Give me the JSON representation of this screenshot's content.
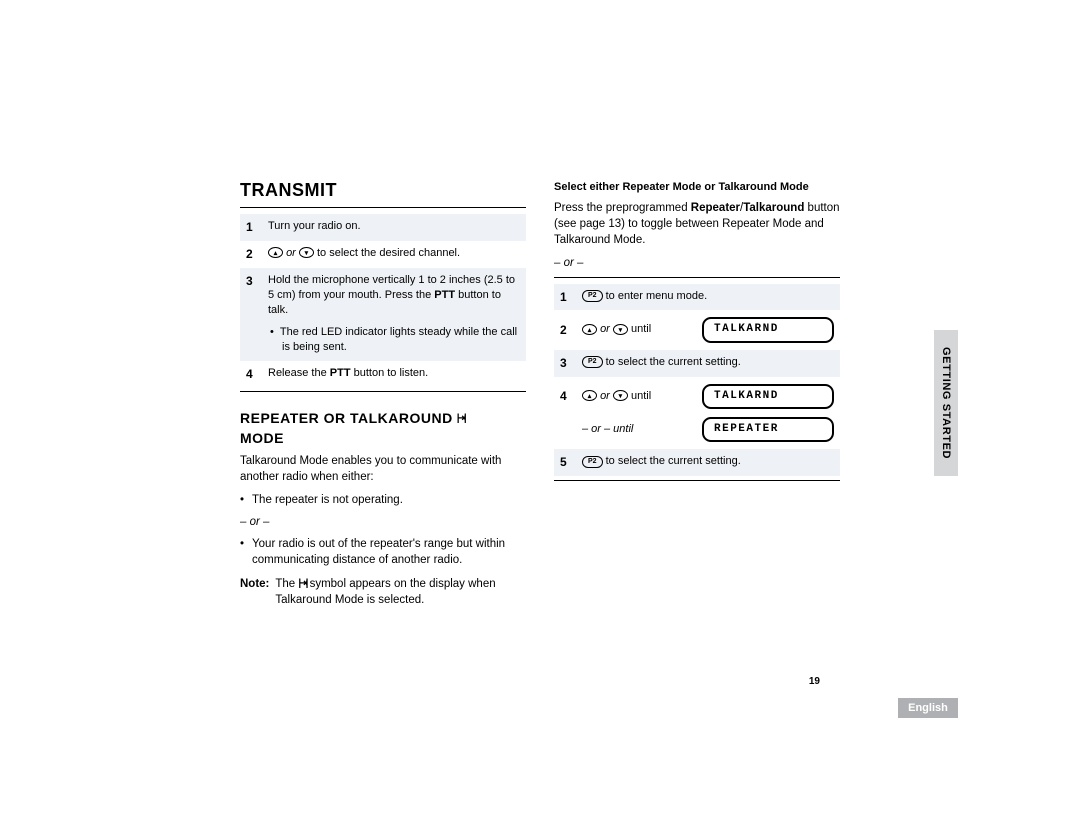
{
  "left": {
    "h1": "TRANSMIT",
    "steps": [
      {
        "n": "1",
        "text": "Turn your radio on."
      },
      {
        "n": "2",
        "pre": "",
        "mid": " or ",
        "post": " to select the desired channel."
      },
      {
        "n": "3",
        "text": "Hold the microphone vertically 1 to 2 inches (2.5 to 5 cm) from your mouth. Press the ",
        "bold": "PTT",
        "after": " button to talk.",
        "nested": "The red LED indicator lights steady while the call is being sent."
      },
      {
        "n": "4",
        "text": "Release the ",
        "bold": "PTT",
        "after": " button to listen."
      }
    ],
    "h2a": "REPEATER OR TALKAROUND",
    "h2b": "MODE",
    "intro": "Talkaround Mode enables you to communicate with another radio when either:",
    "b1": "The repeater is not operating.",
    "or": "– or –",
    "b2": "Your radio is out of the repeater's range but within communicating distance of another radio.",
    "noteLabel": "Note:",
    "noteA": "The ",
    "noteB": " symbol appears on the display when Talkaround Mode is selected."
  },
  "right": {
    "subh": "Select either Repeater Mode or Talkaround Mode",
    "p1a": "Press the preprogrammed ",
    "p1b": "Repeater",
    "p1c": "/",
    "p1d": "Talkaround",
    "p1e": " button (see page 13) to toggle between Repeater Mode and Talkaround Mode.",
    "or": "– or –",
    "s1": {
      "n": "1",
      "key": "P2",
      "text": " to enter menu mode."
    },
    "s2": {
      "n": "2",
      "mid": " or ",
      "post": " until",
      "lcd": "TALKARND"
    },
    "s3": {
      "n": "3",
      "key": "P2",
      "text": " to select the current setting."
    },
    "s4": {
      "n": "4",
      "mid": " or ",
      "post": " until",
      "lcd": "TALKARND",
      "oruntil": "– or – until",
      "lcd2": "REPEATER"
    },
    "s5": {
      "n": "5",
      "key": "P2",
      "text": " to select the current setting."
    }
  },
  "side": "GETTING STARTED",
  "lang": "English",
  "pageNum": "19",
  "icons": {
    "up": "▴",
    "down": "▾",
    "talk": "|⇥|"
  }
}
